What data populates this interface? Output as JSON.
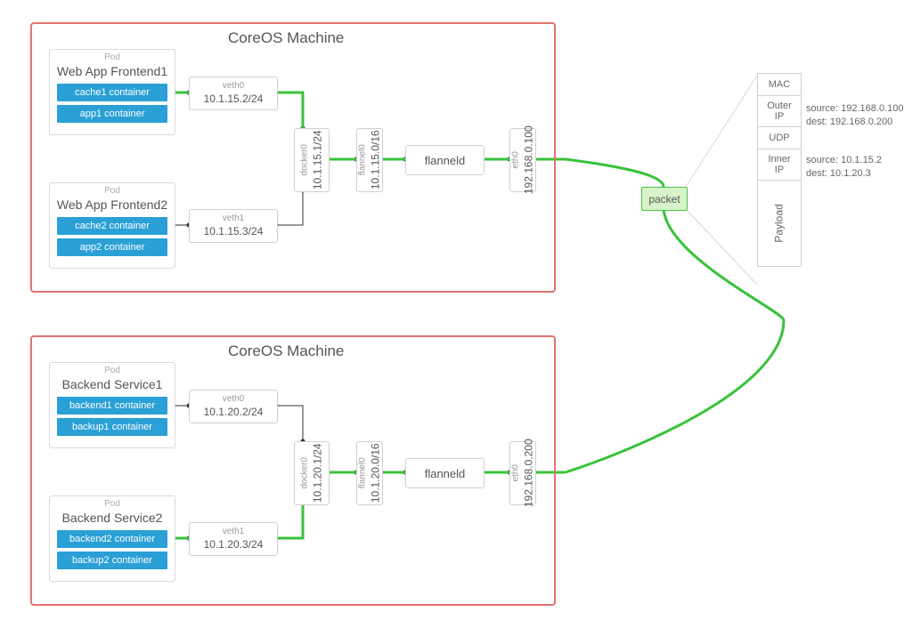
{
  "machines": [
    {
      "title": "CoreOS Machine",
      "pods": [
        {
          "tag": "Pod",
          "title": "Web App Frontend1",
          "containers": [
            "cache1 container",
            "app1 container"
          ],
          "veth": {
            "name": "veth0",
            "cidr": "10.1.15.2/24"
          }
        },
        {
          "tag": "Pod",
          "title": "Web App Frontend2",
          "containers": [
            "cache2 container",
            "app2 container"
          ],
          "veth": {
            "name": "veth1",
            "cidr": "10.1.15.3/24"
          }
        }
      ],
      "docker0": {
        "name": "docker0",
        "cidr": "10.1.15.1/24"
      },
      "flannel0": {
        "name": "flannel0",
        "cidr": "10.1.15.0/16"
      },
      "flanneld": "flanneld",
      "eth0": {
        "name": "eth0",
        "ip": "192.168.0.100"
      }
    },
    {
      "title": "CoreOS Machine",
      "pods": [
        {
          "tag": "Pod",
          "title": "Backend Service1",
          "containers": [
            "backend1 container",
            "backup1 container"
          ],
          "veth": {
            "name": "veth0",
            "cidr": "10.1.20.2/24"
          }
        },
        {
          "tag": "Pod",
          "title": "Backend Service2",
          "containers": [
            "backend2 container",
            "backup2 container"
          ],
          "veth": {
            "name": "veth1",
            "cidr": "10.1.20.3/24"
          }
        }
      ],
      "docker0": {
        "name": "docker0",
        "cidr": "10.1.20.1/24"
      },
      "flannel0": {
        "name": "flannel0",
        "cidr": "10.1.20.0/16"
      },
      "flanneld": "flanneld",
      "eth0": {
        "name": "eth0",
        "ip": "192.168.0.200"
      }
    }
  ],
  "packet": {
    "label": "packet",
    "stack": {
      "mac": "MAC",
      "outer_ip": "Outer\nIP",
      "udp": "UDP",
      "inner_ip": "Inner\nIP",
      "payload": "Payload"
    },
    "outer_note": {
      "source": "source: 192.168.0.100",
      "dest": "dest: 192.168.0.200"
    },
    "inner_note": {
      "source": "source: 10.1.15.2",
      "dest": "dest: 10.1.20.3"
    }
  }
}
